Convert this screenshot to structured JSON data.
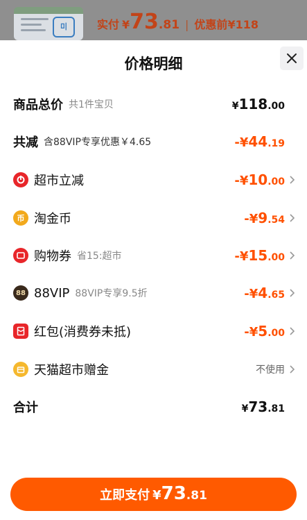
{
  "top": {
    "actual_label": "实付",
    "currency": "¥",
    "actual_int": "73",
    "actual_dec": ".81",
    "separator": "|",
    "original_label": "优惠前",
    "original_value": "¥118"
  },
  "sheet": {
    "title": "价格明细"
  },
  "total_price": {
    "label": "商品总价",
    "sub": "共1件宝贝",
    "currency": "¥",
    "int": "118",
    "dec": ".00"
  },
  "total_discount": {
    "label": "共减",
    "sub": "含88VIP专享优惠￥4.65",
    "prefix": "-¥",
    "int": "44",
    "dec": ".19"
  },
  "discounts": [
    {
      "name": "超市立减",
      "sub": "",
      "prefix": "-¥",
      "int": "10",
      "dec": ".00",
      "icon": "supermarket-discount-icon",
      "icon_color": "#e8262a",
      "icon_glyph": "⟳"
    },
    {
      "name": "淘金币",
      "sub": "",
      "prefix": "-¥",
      "int": "9",
      "dec": ".54",
      "icon": "taojinbi-coin-icon",
      "icon_color": "#f2a91c",
      "icon_glyph": "币"
    },
    {
      "name": "购物券",
      "sub": "省15:超市",
      "prefix": "-¥",
      "int": "15",
      "dec": ".00",
      "icon": "coupon-icon",
      "icon_color": "#e8262a",
      "icon_glyph": "▬"
    },
    {
      "name": "88VIP",
      "sub": "88VIP专享9.5折",
      "prefix": "-¥",
      "int": "4",
      "dec": ".65",
      "icon": "88vip-icon",
      "icon_color": "#3a2a1c",
      "icon_glyph": "88"
    },
    {
      "name": "红包(消费券未抵)",
      "sub": "",
      "prefix": "-¥",
      "int": "5",
      "dec": ".00",
      "icon": "red-packet-icon",
      "icon_color": "#e8262a",
      "icon_glyph": "红"
    }
  ],
  "tmall_gift": {
    "name": "天猫超市赠金",
    "status": "不使用",
    "icon": "tmall-gift-icon",
    "icon_color": "#f5b82e"
  },
  "sum": {
    "label": "合计",
    "currency": "¥",
    "int": "73",
    "dec": ".81"
  },
  "pay": {
    "label": "立即支付",
    "currency": "¥",
    "int": "73",
    "dec": ".81"
  },
  "colors": {
    "accent": "#ff5000",
    "pay_button": "#ff5a00"
  }
}
